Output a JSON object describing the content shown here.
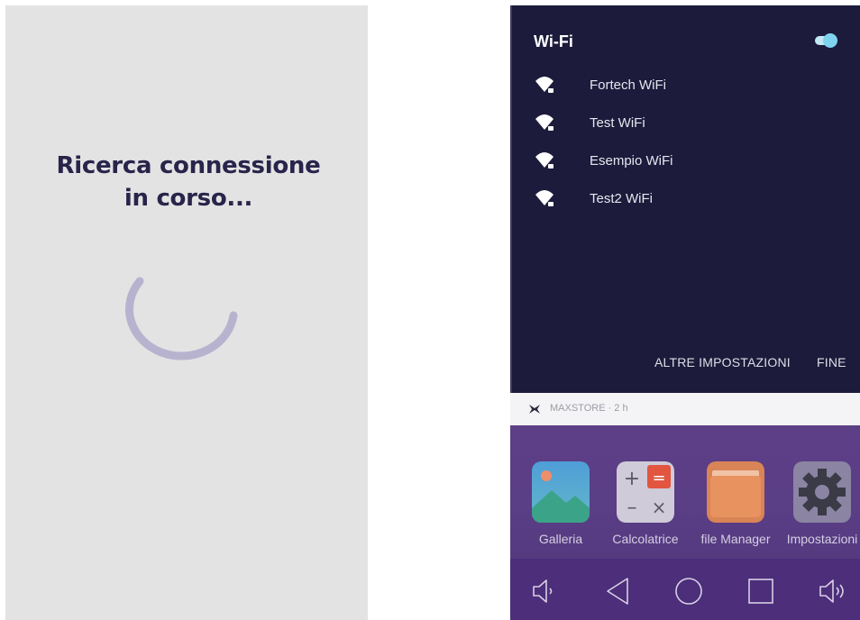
{
  "loading": {
    "title_line1": "Ricerca connessione",
    "title_line2": "in corso..."
  },
  "wifi_panel": {
    "title": "Wi-Fi",
    "toggle_state": "on",
    "networks": [
      {
        "name": "Fortech WiFi",
        "icon": "wifi-locked-icon"
      },
      {
        "name": "Test WiFi",
        "icon": "wifi-locked-icon"
      },
      {
        "name": "Esempio WiFi",
        "icon": "wifi-locked-icon"
      },
      {
        "name": "Test2 WiFi",
        "icon": "wifi-locked-icon"
      }
    ],
    "more_settings_label": "ALTRE IMPOSTAZIONI",
    "done_label": "FINE"
  },
  "notification": {
    "text": "MAXSTORE · 2 h",
    "icon": "maxstore-icon"
  },
  "apps": [
    {
      "label": "Galleria",
      "icon": "gallery-icon"
    },
    {
      "label": "Calcolatrice",
      "icon": "calculator-icon"
    },
    {
      "label": "file Manager",
      "icon": "folder-icon"
    },
    {
      "label": "Impostazioni",
      "icon": "gear-icon"
    }
  ],
  "navbar": {
    "buttons": [
      "volume-down-icon",
      "back-icon",
      "home-icon",
      "recents-icon",
      "volume-up-icon"
    ]
  },
  "colors": {
    "loading_bg": "#e3e3e3",
    "title_text": "#28244a",
    "spinner": "#b7b3cf",
    "wifi_panel_bg": "#1c1b3b",
    "toggle_accent": "#7fd3ef",
    "home_bg": "#5a3e86",
    "navbar_bg": "#4c2e7a"
  }
}
